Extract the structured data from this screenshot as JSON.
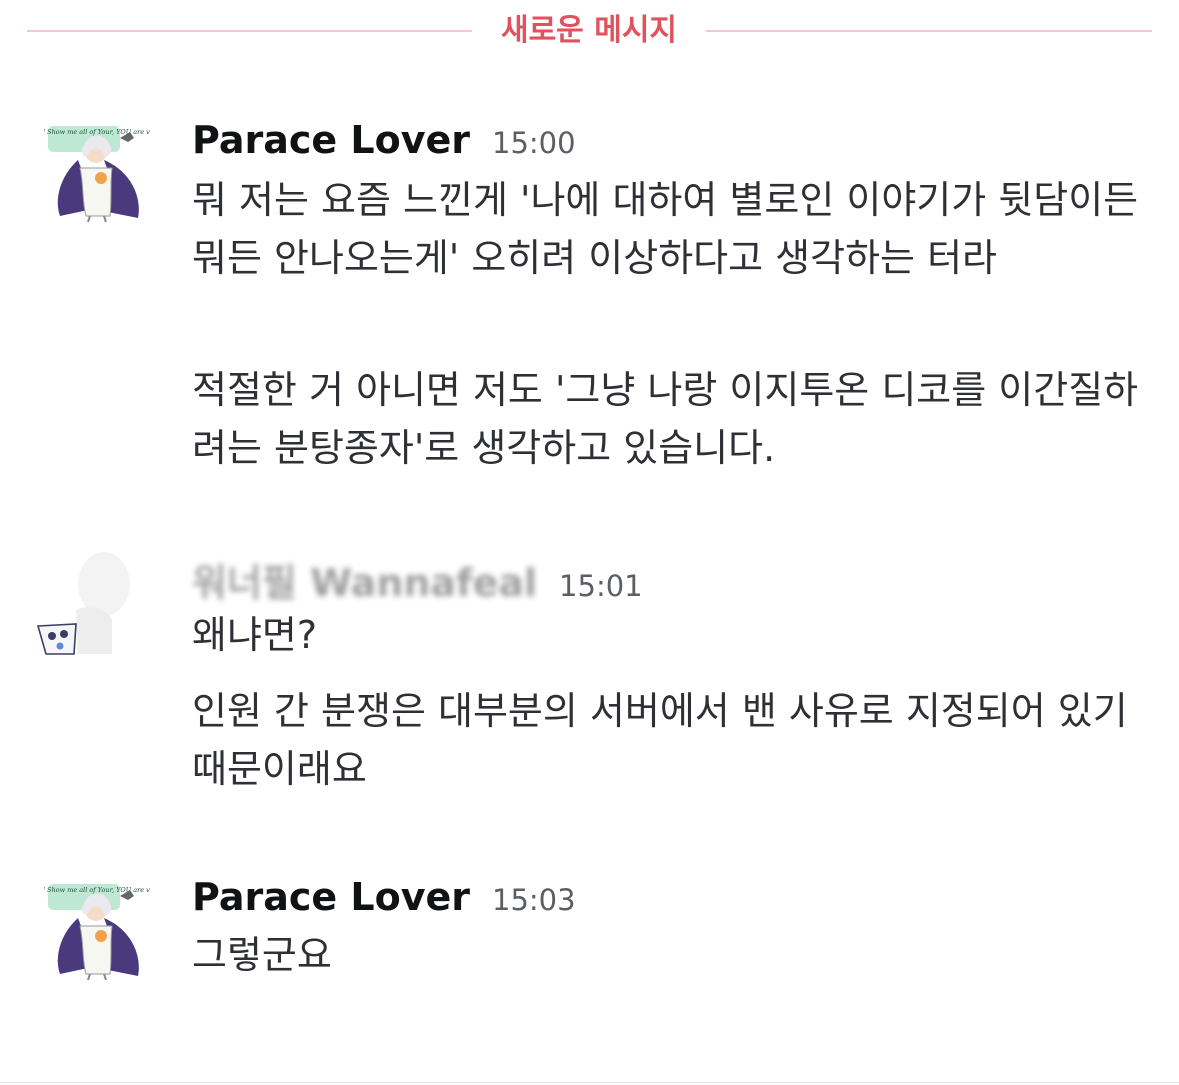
{
  "divider": {
    "label": "새로운 메시지"
  },
  "messages": [
    {
      "author": "Parace Lover",
      "time": "15:00",
      "lines": [
        "뭐 저는 요즘 느낀게 '나에 대하여 별로인 이야기가 뒷담이든 뭐든 안나오는게' 오히려 이상하다고 생각하는 터라",
        "적절한 거 아니면 저도 '그냥 나랑 이지투온 디코를 이간질하려는 분탕종자'로 생각하고 있습니다."
      ]
    },
    {
      "author": "워너필 Wannafeal",
      "time": "15:01",
      "lines": [
        "왜냐면?",
        "인원 간 분쟁은 대부분의 서버에서 밴 사유로 지정되어 있기 때문이래요"
      ]
    },
    {
      "author": "Parace Lover",
      "time": "15:03",
      "lines": [
        "그렇군요"
      ]
    }
  ],
  "avatar_text": "Enjoy My Story, and Show me all of Your, YOU are very Special!",
  "colors": {
    "divider_text": "#e0525d",
    "divider_line": "#f5c6cb",
    "author": "#111214",
    "timestamp": "#5c5e66",
    "body_text": "#2e3035"
  }
}
